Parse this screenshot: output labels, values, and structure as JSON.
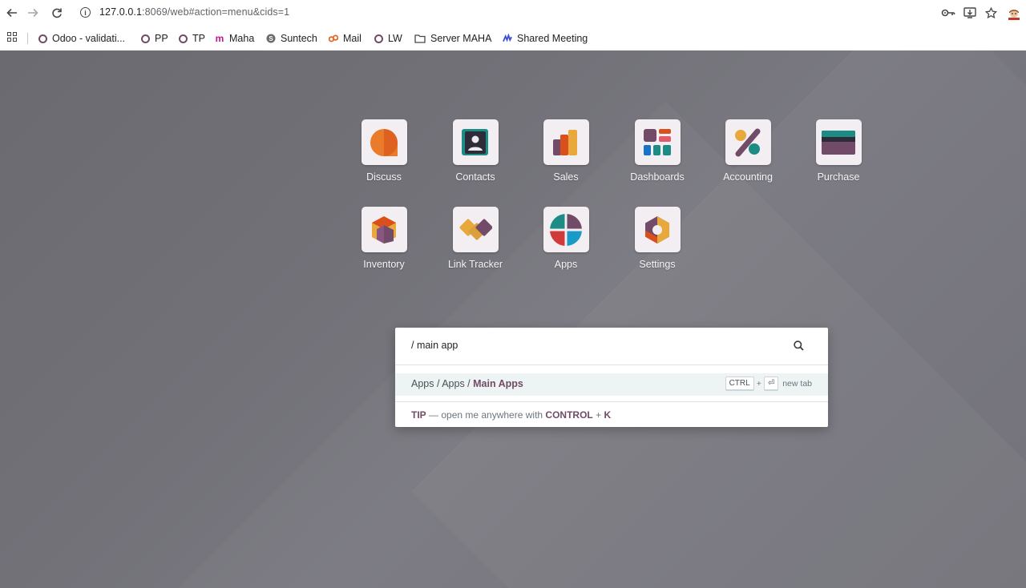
{
  "browser": {
    "url_host": "127.0.0.1",
    "url_rest": ":8069/web#action=menu&cids=1"
  },
  "bookmarks": [
    {
      "label": "Odoo - validati...",
      "icon": "odoo-ring-icon"
    },
    {
      "label": "PP",
      "icon": "odoo-ring-icon"
    },
    {
      "label": "TP",
      "icon": "odoo-ring-icon"
    },
    {
      "label": "Maha",
      "icon": "m-logo-icon"
    },
    {
      "label": "Suntech",
      "icon": "s-logo-icon"
    },
    {
      "label": "Mail",
      "icon": "mail-logo-icon"
    },
    {
      "label": "LW",
      "icon": "odoo-ring-icon"
    },
    {
      "label": "Server MAHA",
      "icon": "folder-icon"
    },
    {
      "label": "Shared Meeting",
      "icon": "meeting-logo-icon"
    }
  ],
  "apps": [
    {
      "label": "Discuss",
      "icon": "discuss-icon"
    },
    {
      "label": "Contacts",
      "icon": "contacts-icon"
    },
    {
      "label": "Sales",
      "icon": "sales-icon"
    },
    {
      "label": "Dashboards",
      "icon": "dashboards-icon"
    },
    {
      "label": "Accounting",
      "icon": "accounting-icon"
    },
    {
      "label": "Purchase",
      "icon": "purchase-icon"
    },
    {
      "label": "Inventory",
      "icon": "inventory-icon"
    },
    {
      "label": "Link Tracker",
      "icon": "link-tracker-icon"
    },
    {
      "label": "Apps",
      "icon": "apps-icon"
    },
    {
      "label": "Settings",
      "icon": "settings-icon"
    }
  ],
  "palette": {
    "query": "/ main app",
    "result_prefix": "Apps / Apps / ",
    "result_highlight": "Main Apps",
    "hotkey_ctrl": "CTRL",
    "hotkey_plus": "+",
    "hotkey_enter": "⏎",
    "hotkey_text": "new tab",
    "tip_label": "TIP",
    "tip_text": " — open me anywhere with ",
    "tip_key1": "CONTROL",
    "tip_plus": " + ",
    "tip_key2": "K"
  },
  "colors": {
    "brand": "#714b67",
    "background": "#727178"
  }
}
